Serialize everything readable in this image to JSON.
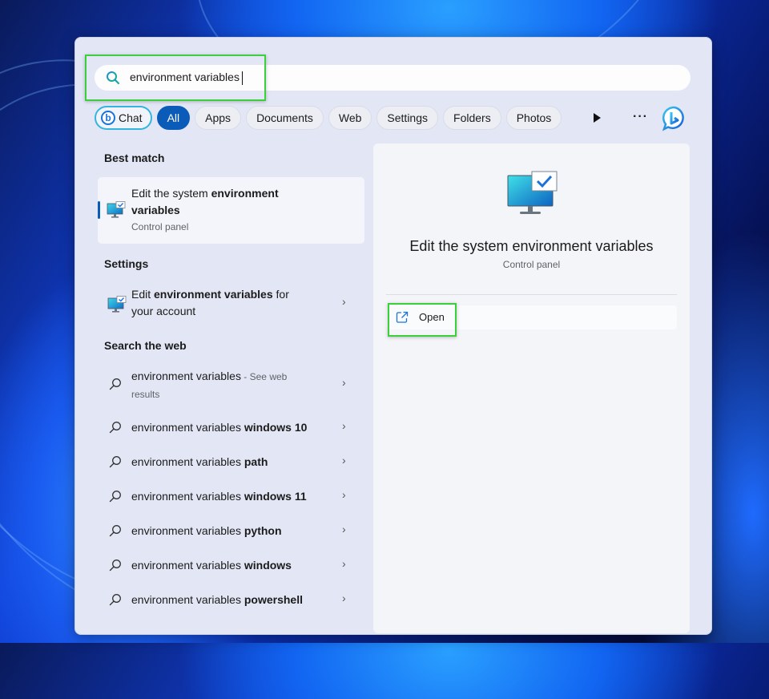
{
  "search": {
    "query": "environment variables",
    "icon": "search-icon"
  },
  "filters": {
    "chat_label": "Chat",
    "items": [
      "All",
      "Apps",
      "Documents",
      "Web",
      "Settings",
      "Folders",
      "Photos"
    ],
    "active": "All",
    "play_icon": "play-icon",
    "more_label": "···",
    "bing_icon": "bing-chat-icon"
  },
  "left": {
    "best_match": {
      "heading": "Best match",
      "title_plain": "Edit the system ",
      "title_bold": "environment variables",
      "subtitle": "Control panel",
      "icon": "monitor-check-icon"
    },
    "settings": {
      "heading": "Settings",
      "prefix": "Edit ",
      "bold": "environment variables",
      "suffix": " for your account",
      "icon": "monitor-check-icon"
    },
    "web": {
      "heading": "Search the web",
      "first": {
        "text": "environment variables",
        "hint": " - See web results"
      },
      "items": [
        {
          "base": "environment variables ",
          "bold": "windows 10"
        },
        {
          "base": "environment variables ",
          "bold": "path"
        },
        {
          "base": "environment variables ",
          "bold": "windows 11"
        },
        {
          "base": "environment variables ",
          "bold": "python"
        },
        {
          "base": "environment variables ",
          "bold": "windows"
        },
        {
          "base": "environment variables ",
          "bold": "powershell"
        }
      ]
    }
  },
  "right": {
    "title": "Edit the system environment variables",
    "subtitle": "Control panel",
    "action_label": "Open",
    "action_icon": "open-external-icon"
  },
  "colors": {
    "accent": "#0b5cb8",
    "highlight_box": "#3ccf3c",
    "panel_bg": "#e3e7f5"
  }
}
